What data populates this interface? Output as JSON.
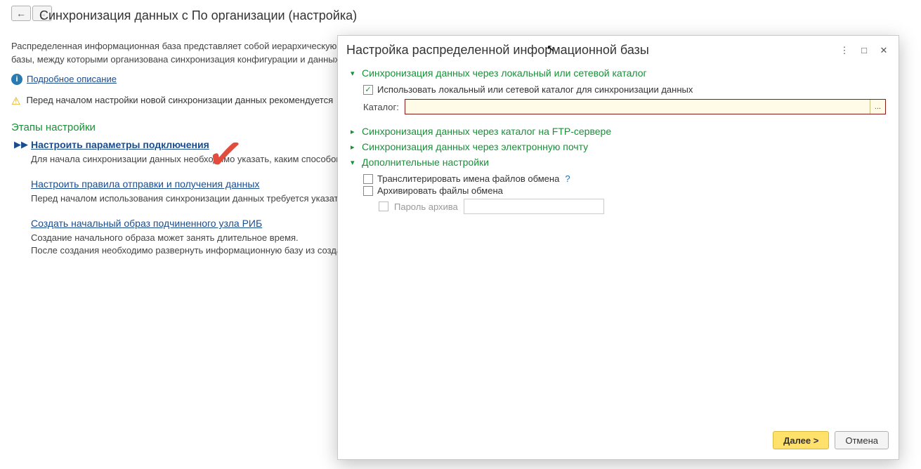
{
  "bg": {
    "title": "Синхронизация данных с По организации (настройка)",
    "para": "Распределенная информационная база представляет собой иерархическую структуру, состоящую из отдельных информационных баз системы «1С:Предприятие» — узлов распределенной информационной базы, между которыми организована синхронизация конфигурации и данных. Главной особенностью данного вида синхронизации является возможность миграции данных по организациям.",
    "detail_link": "Подробное описание",
    "warn": "Перед началом настройки новой синхронизации данных рекомендуется ",
    "steps_h": "Этапы настройки",
    "step1_link": "Настроить параметры подключения",
    "step1_desc": "Для начала синхронизации данных необходимо указать, каким способом",
    "step2_link": "Настроить правила отправки и получения данных",
    "step2_desc": "Перед началом использования синхронизации данных требуется указать",
    "step3_link": "Создать начальный образ подчиненного узла РИБ",
    "step3_desc": "Создание начального образа может занять длительное время.\nПосле создания необходимо развернуть информационную базу из созданного образа, открыть ее. необходимо открыть параметры настроенной синхронизации и выполнить"
  },
  "modal": {
    "title": "Настройка распределенной информационной базы",
    "g1": {
      "title": "Синхронизация данных через локальный или сетевой каталог",
      "chk_label": "Использовать локальный или сетевой каталог для синхронизации данных",
      "field_label": "Каталог:",
      "field_value": "",
      "browse": "..."
    },
    "g2": {
      "title": "Синхронизация данных через каталог на FTP-сервере"
    },
    "g3": {
      "title": "Синхронизация данных через электронную почту"
    },
    "g4": {
      "title": "Дополнительные настройки",
      "chk1": "Транслитерировать имена файлов обмена",
      "chk2": "Архивировать файлы обмена",
      "pw_label": "Пароль архива",
      "pw_value": ""
    },
    "next": "Далее >",
    "cancel": "Отмена"
  }
}
